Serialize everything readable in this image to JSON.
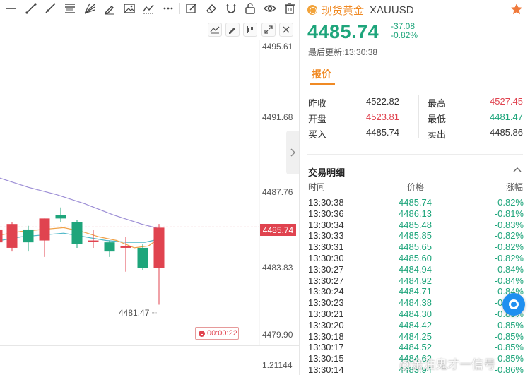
{
  "chart": {
    "y_labels": [
      "4495.61",
      "4491.68",
      "4487.76",
      "4483.83",
      "4479.90"
    ],
    "current_price_tag": "4485.74",
    "low_note": "4481.47",
    "timer": "00:00:22",
    "indicator_value": "1.21144",
    "colors": {
      "up": "#e0434f",
      "down": "#1ea57b",
      "ma_purple": "#9d8fd6",
      "ma_orange": "#f0a24a",
      "ma_teal": "#4fb8c9"
    },
    "candles": [
      {
        "open": 4484.9,
        "close": 4485.6,
        "high": 4485.9,
        "low": 4484.6
      },
      {
        "open": 4484.6,
        "close": 4485.9,
        "high": 4486.0,
        "low": 4484.4
      },
      {
        "open": 4485.6,
        "close": 4484.9,
        "high": 4485.8,
        "low": 4484.4
      },
      {
        "open": 4485.0,
        "close": 4486.2,
        "high": 4486.2,
        "low": 4484.1
      },
      {
        "open": 4486.4,
        "close": 4486.2,
        "high": 4486.8,
        "low": 4486.0
      },
      {
        "open": 4486.0,
        "close": 4484.8,
        "high": 4486.1,
        "low": 4484.6
      },
      {
        "open": 4485.0,
        "close": 4485.0,
        "high": 4485.6,
        "low": 4484.6
      },
      {
        "open": 4484.9,
        "close": 4484.4,
        "high": 4485.0,
        "low": 4484.1
      },
      {
        "open": 4484.6,
        "close": 4484.7,
        "high": 4485.2,
        "low": 4483.3
      },
      {
        "open": 4484.6,
        "close": 4483.5,
        "high": 4484.8,
        "low": 4483.4
      },
      {
        "open": 4483.5,
        "close": 4485.7,
        "high": 4485.9,
        "low": 4481.5
      }
    ]
  },
  "header": {
    "name": "现货黄金",
    "symbol": "XAUUSD",
    "price": "4485.74",
    "change": "-37.08",
    "change_pct": "-0.82%",
    "update_label": "最后更新:13:30:38"
  },
  "tab": {
    "quote": "报价"
  },
  "quote": {
    "left": [
      {
        "label": "昨收",
        "value": "4522.82",
        "color": "normal"
      },
      {
        "label": "开盘",
        "value": "4523.81",
        "color": "red"
      },
      {
        "label": "买入",
        "value": "4485.74",
        "color": "normal"
      }
    ],
    "right": [
      {
        "label": "最高",
        "value": "4527.45",
        "color": "red"
      },
      {
        "label": "最低",
        "value": "4481.47",
        "color": "green"
      },
      {
        "label": "卖出",
        "value": "4485.86",
        "color": "normal"
      }
    ]
  },
  "trades_section": {
    "title": "交易明细",
    "col_time": "时间",
    "col_price": "价格",
    "col_change": "涨幅",
    "rows": [
      {
        "time": "13:30:38",
        "price": "4485.74",
        "change": "-0.82%"
      },
      {
        "time": "13:30:36",
        "price": "4486.13",
        "change": "-0.81%"
      },
      {
        "time": "13:30:34",
        "price": "4485.48",
        "change": "-0.83%"
      },
      {
        "time": "13:30:33",
        "price": "4485.85",
        "change": "-0.82%"
      },
      {
        "time": "13:30:31",
        "price": "4485.65",
        "change": "-0.82%"
      },
      {
        "time": "13:30:30",
        "price": "4485.60",
        "change": "-0.82%"
      },
      {
        "time": "13:30:27",
        "price": "4484.94",
        "change": "-0.84%"
      },
      {
        "time": "13:30:27",
        "price": "4484.92",
        "change": "-0.84%"
      },
      {
        "time": "13:30:24",
        "price": "4484.71",
        "change": "-0.84%"
      },
      {
        "time": "13:30:23",
        "price": "4484.38",
        "change": "-0.85%"
      },
      {
        "time": "13:30:21",
        "price": "4484.30",
        "change": "-0.85%"
      },
      {
        "time": "13:30:20",
        "price": "4484.42",
        "change": "-0.85%"
      },
      {
        "time": "13:30:18",
        "price": "4484.25",
        "change": "-0.85%"
      },
      {
        "time": "13:30:17",
        "price": "4484.52",
        "change": "-0.85%"
      },
      {
        "time": "13:30:15",
        "price": "4484.62",
        "change": "-0.85%"
      },
      {
        "time": "13:30:14",
        "price": "4483.94",
        "change": "-0.86%"
      }
    ]
  },
  "watermark": "@金油鬼才一信号"
}
